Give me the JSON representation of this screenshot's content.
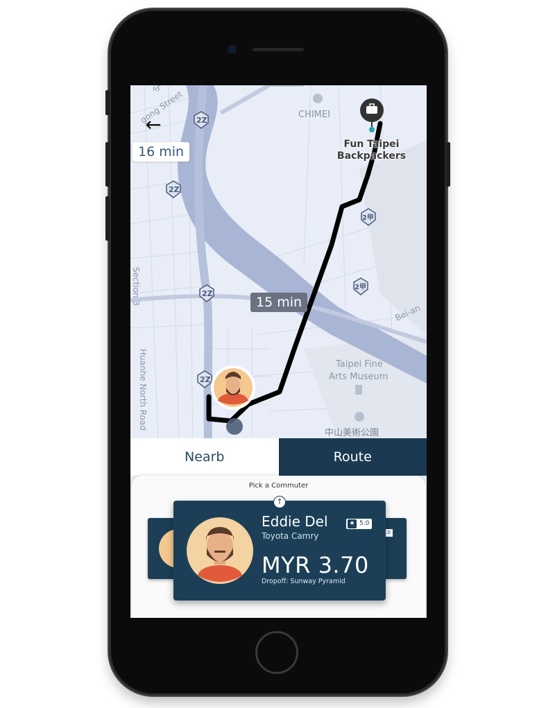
{
  "map": {
    "eta_top": "16 min",
    "eta_route": "15 min",
    "poi_name": "Fun Taipei Backpackers",
    "district": "CHIMEI",
    "museum": "Taipei Fine Arts Museum",
    "park": "中山美術公園",
    "road_left": "Huanhe North Road",
    "road_section": "Section 3",
    "road_section2": "Section 2",
    "street_top": "gong Street",
    "road_right": "Bei-an",
    "highway_shield": "2Z",
    "provincial_shield": "2甲"
  },
  "tabs": [
    {
      "label": "Nearb"
    },
    {
      "label": "Route"
    }
  ],
  "panel": {
    "title": "Pick a Commuter"
  },
  "commuter": {
    "name": "Eddie Del",
    "car": "Toyota Camry",
    "rating": "5.0",
    "price": "MYR 3.70",
    "dropoff": "Dropoff: Sunway Pyramid"
  },
  "side_card": {
    "rating": "5.0",
    "price_fragment": "0"
  },
  "colors": {
    "card": "#1c3f57",
    "tab_active": "#1b3a52",
    "map_bg": "#e8edf7",
    "river": "#a9b5d4",
    "route": "#000000"
  },
  "icons": {
    "back": "arrow-left-icon",
    "briefcase": "briefcase-icon",
    "star": "star-icon",
    "up": "arrow-up-icon"
  }
}
